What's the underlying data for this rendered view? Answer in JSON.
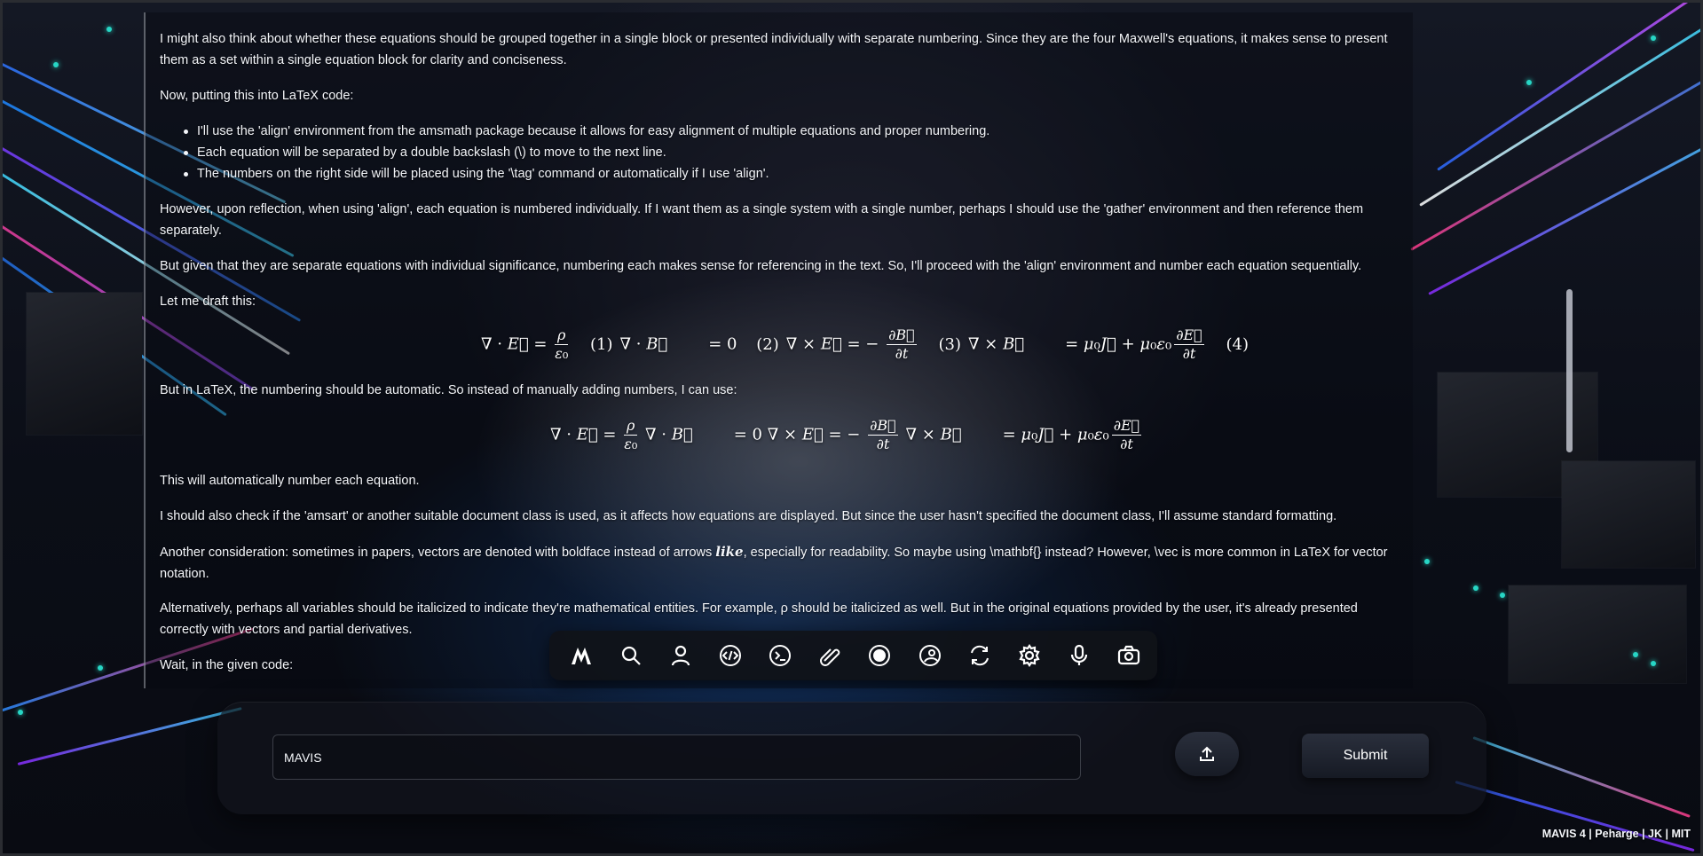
{
  "transcript": {
    "p1": "I might also think about whether these equations should be grouped together in a single block or presented individually with separate numbering. Since they are the four Maxwell's equations, it makes sense to present them as a set within a single equation block for clarity and conciseness.",
    "p2": "Now, putting this into LaTeX code:",
    "bullets": [
      "I'll use the 'align' environment from the amsmath package because it allows for easy alignment of multiple equations and proper numbering.",
      "Each equation will be separated by a double backslash (\\) to move to the next line.",
      "The numbers on the right side will be placed using the '\\tag' command or automatically if I use 'align'."
    ],
    "p3": "However, upon reflection, when using 'align', each equation is numbered individually. If I want them as a single system with a single number, perhaps I should use the 'gather' environment and then reference them separately.",
    "p4": "But given that they are separate equations with individual significance, numbering each makes sense for referencing in the text. So, I'll proceed with the 'align' environment and number each equation sequentially.",
    "p5": "Let me draft this:",
    "eq1_tags": [
      "(1)",
      "(2)",
      "(3)",
      "(4)"
    ],
    "p6": "But in LaTeX, the numbering should be automatic. So instead of manually adding numbers, I can use:",
    "p7": "This will automatically number each equation.",
    "p8": "I should also check if the 'amsart' or another suitable document class is used, as it affects how equations are displayed. But since the user hasn't specified the document class, I'll assume standard formatting.",
    "p9_before": "Another consideration: sometimes in papers, vectors are denoted with boldface instead of arrows ",
    "p9_like": "like",
    "p9_after": ", especially for readability. So maybe using \\mathbf{} instead? However, \\vec is more common in LaTeX for vector notation.",
    "p10": "Alternatively, perhaps all variables should be italicized to indicate they're mathematical entities. For example, ρ should be italicized as well. But in the original equations provided by the user, it's already presented correctly with vectors and partial derivatives.",
    "p11": "Wait, in the given code:"
  },
  "toolbar": {
    "tools": [
      {
        "icon": "mavis-logo-icon"
      },
      {
        "icon": "search-icon"
      },
      {
        "icon": "user-icon"
      },
      {
        "icon": "code-icon"
      },
      {
        "icon": "terminal-icon"
      },
      {
        "icon": "attach-pen-icon"
      },
      {
        "icon": "record-icon"
      },
      {
        "icon": "face-icon"
      },
      {
        "icon": "refresh-icon"
      },
      {
        "icon": "settings-icon"
      },
      {
        "icon": "microphone-icon"
      },
      {
        "icon": "camera-icon"
      }
    ]
  },
  "input": {
    "placeholder": "MAVIS"
  },
  "buttons": {
    "submit_label": "Submit",
    "upload_icon": "upload-icon"
  },
  "footer": {
    "text": "MAVIS 4 | Peharge | JK | MIT"
  },
  "colors": {
    "text": "#f4f6fa",
    "accent_teal": "#27d6c5",
    "panel": "#12141c"
  }
}
